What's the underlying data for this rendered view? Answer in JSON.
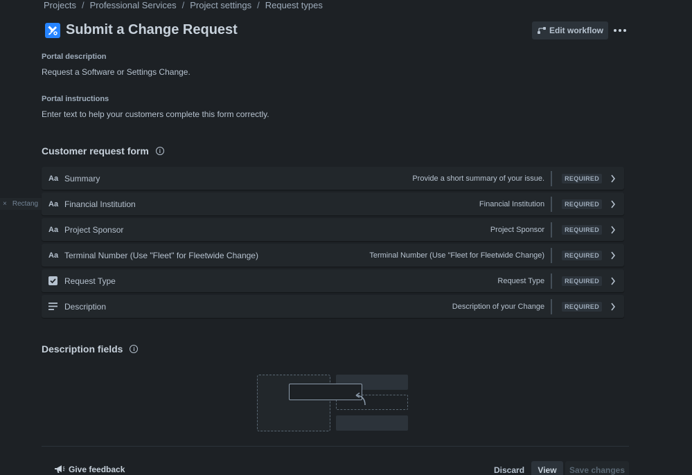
{
  "breadcrumb": [
    "Projects",
    "Professional Services",
    "Project settings",
    "Request types"
  ],
  "page": {
    "title": "Submit a Change Request",
    "edit_workflow_label": "Edit workflow"
  },
  "portal_description": {
    "label": "Portal description",
    "text": "Request a Software or Settings Change."
  },
  "portal_instructions": {
    "label": "Portal instructions",
    "text": "Enter text to help your customers complete this form correctly."
  },
  "customer_request_form": {
    "title": "Customer request form",
    "fields": [
      {
        "icon": "text-field-icon",
        "glyph": "Aa",
        "name": "Summary",
        "description": "Provide a short summary of your issue.",
        "badge": "REQUIRED"
      },
      {
        "icon": "text-field-icon",
        "glyph": "Aa",
        "name": "Financial Institution",
        "description": "Financial Institution",
        "badge": "REQUIRED"
      },
      {
        "icon": "text-field-icon",
        "glyph": "Aa",
        "name": "Project Sponsor",
        "description": "Project Sponsor",
        "badge": "REQUIRED"
      },
      {
        "icon": "text-field-icon",
        "glyph": "Aa",
        "name": "Terminal Number (Use \"Fleet\" for Fleetwide Change)",
        "description": "Terminal Number (Use \"Fleet for Fleetwide Change)",
        "badge": "REQUIRED"
      },
      {
        "icon": "checkbox-icon",
        "glyph": "",
        "name": "Request Type",
        "description": "Request Type",
        "badge": "REQUIRED"
      },
      {
        "icon": "paragraph-icon",
        "glyph": "",
        "name": "Description",
        "description": "Description of your Change",
        "badge": "REQUIRED"
      }
    ]
  },
  "description_fields": {
    "title": "Description fields"
  },
  "ghost_tab": "Rectang",
  "footer": {
    "feedback_label": "Give feedback",
    "discard_label": "Discard",
    "view_label": "View",
    "save_label": "Save changes"
  },
  "colors": {
    "background": "#1d2125",
    "row": "#22272b",
    "accent": "#2684ff"
  }
}
